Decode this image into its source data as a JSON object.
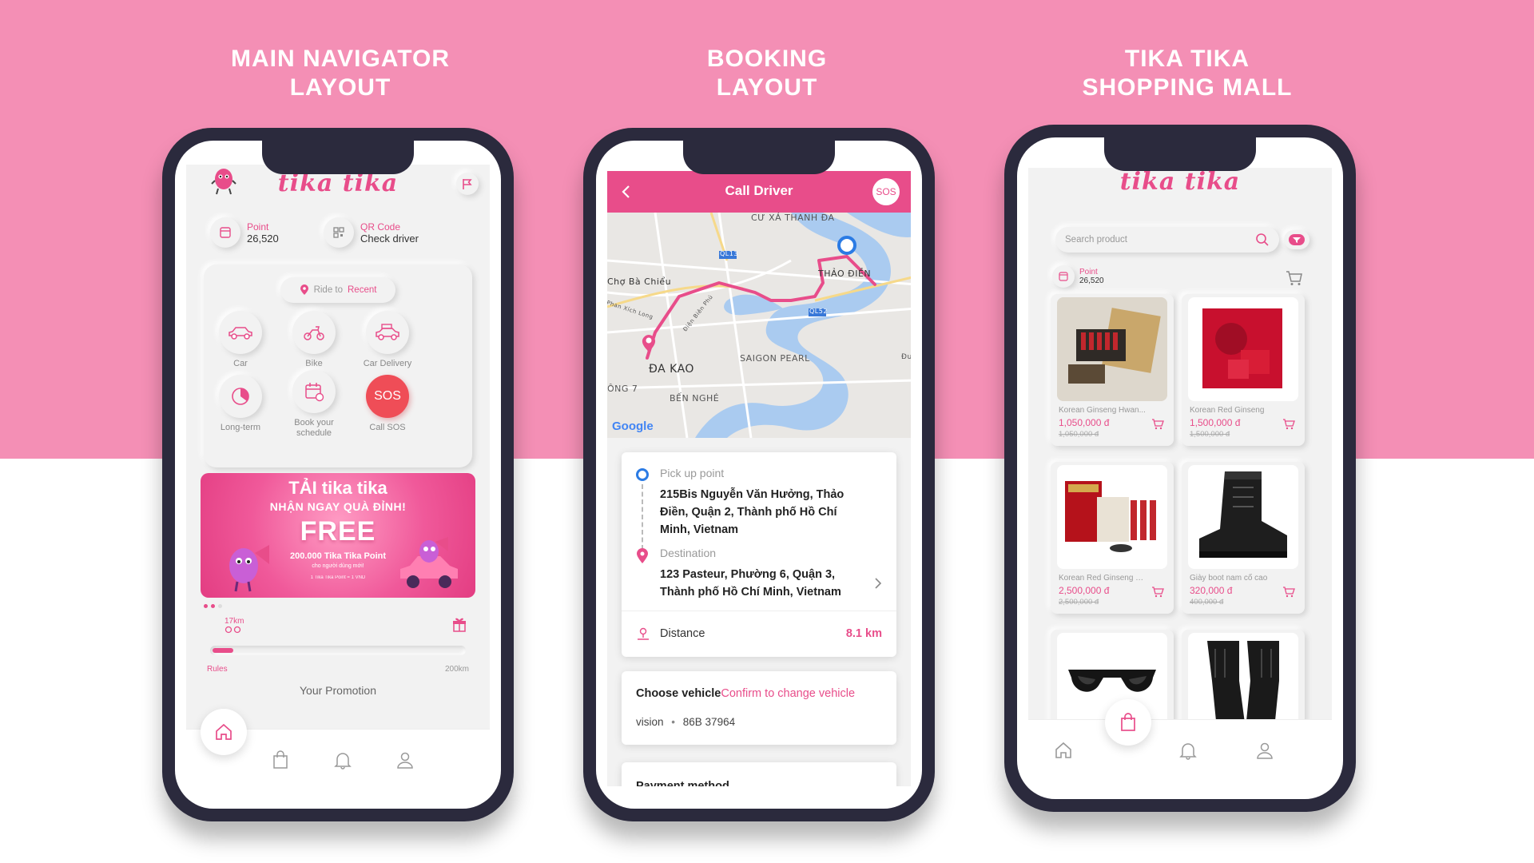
{
  "headings": {
    "main_nav_line1": "MAIN NAVIGATOR",
    "main_nav_line2": "LAYOUT",
    "booking_line1": "BOOKING",
    "booking_line2": "LAYOUT",
    "mall_line1": "TIKA TIKA",
    "mall_line2": "SHOPPING MALL"
  },
  "colors": {
    "brand_pink": "#e84d8a",
    "sos_red": "#ef4d57",
    "page_pink": "#f48fb5",
    "phone_frame": "#2b2a3d"
  },
  "main": {
    "logo": "tika tika",
    "point_label": "Point",
    "point_value": "26,520",
    "qr_label": "QR Code",
    "qr_value": "Check driver",
    "ride_prefix": "Ride to",
    "ride_target": "Recent",
    "services": [
      {
        "label": "Car",
        "icon": "car-icon"
      },
      {
        "label": "Bike",
        "icon": "bike-icon"
      },
      {
        "label": "Car Delivery",
        "icon": "car-delivery-icon"
      },
      {
        "label": "Long-term",
        "icon": "clock-icon"
      },
      {
        "label": "Book your schedule",
        "icon": "calendar-icon"
      },
      {
        "label": "Call SOS",
        "icon": "sos-icon",
        "badge": "SOS"
      }
    ],
    "banner": {
      "title": "TẢI tika tika",
      "subtitle": "NHẬN NGAY QUÀ ĐỈNH!",
      "free": "FREE",
      "points": "200.000 Tika Tika Point",
      "note": "cho người dùng mới!",
      "fine": "1 Tika Tika Point = 1 VND"
    },
    "progress": {
      "current_label": "17km",
      "fraction": 0.08,
      "rules": "Rules",
      "max_label": "200km"
    },
    "promotion_title": "Your Promotion"
  },
  "booking": {
    "title": "Call Driver",
    "sos": "SOS",
    "map_labels": {
      "area1": "CƯ XÁ THANH ĐA",
      "area2": "THẢO ĐIỀN",
      "market": "Chợ Bà Chiểu",
      "area3": "ĐA KAO",
      "area4": "SAIGON PEARL",
      "area5": "BẾN NGHÉ",
      "area6": "ÔNG 7",
      "road1": "QL13",
      "road2": "QL52",
      "road3": "Phan Xích Long",
      "road4": "Điện Biên Phủ",
      "road5": "Đườ",
      "google": "Google"
    },
    "pickup_label": "Pick up point",
    "pickup_address": "215Bis Nguyễn Văn Hưởng, Thảo Điền, Quận 2, Thành phố Hồ Chí Minh, Vietnam",
    "destination_label": "Destination",
    "destination_address": "123 Pasteur, Phường 6, Quận 3, Thành phố Hồ Chí Minh, Vietnam",
    "distance_label": "Distance",
    "distance_value": "8.1 km",
    "vehicle_title": "Choose vehicle",
    "vehicle_action": "Confirm to change vehicle",
    "vehicle_name": "vision",
    "vehicle_plate": "86B 37964",
    "payment_title": "Payment method"
  },
  "shop": {
    "logo": "tika tika",
    "search_placeholder": "Search product",
    "point_label": "Point",
    "point_value": "26,520",
    "products": [
      {
        "name": "Korean Ginseng Hwan...",
        "price": "1,050,000 đ",
        "old_price": "1,050,000 đ"
      },
      {
        "name": "Korean Red Ginseng",
        "price": "1,500,000 đ",
        "old_price": "1,500,000 đ"
      },
      {
        "name": "Korean Red Ginseng Ex...",
        "price": "2,500,000 đ",
        "old_price": "2,500,000 đ"
      },
      {
        "name": "Giày boot nam cổ cao",
        "price": "320,000 đ",
        "old_price": "400,000 đ"
      },
      {
        "name": "",
        "price": "",
        "old_price": ""
      },
      {
        "name": "",
        "price": "",
        "old_price": ""
      }
    ]
  }
}
